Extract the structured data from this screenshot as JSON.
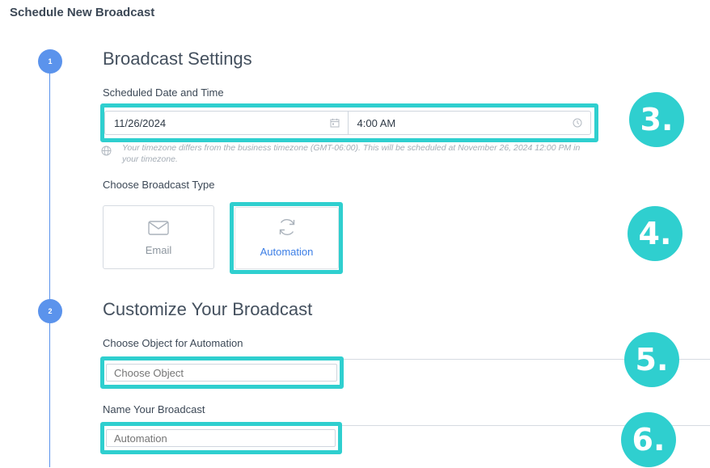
{
  "page": {
    "title": "Schedule New Broadcast"
  },
  "steps": [
    {
      "number": "1",
      "title": "Broadcast Settings"
    },
    {
      "number": "2",
      "title": "Customize Your Broadcast"
    }
  ],
  "schedule": {
    "label": "Scheduled Date and Time",
    "date": "11/26/2024",
    "time": "4:00 AM",
    "timezone_note": "Your timezone differs from the business timezone (GMT-06:00). This will be scheduled at November 26, 2024 12:00 PM in your timezone."
  },
  "broadcast_type": {
    "label": "Choose Broadcast Type",
    "options": [
      {
        "label": "Email",
        "icon": "envelope-icon",
        "selected": false
      },
      {
        "label": "Automation",
        "icon": "refresh-icon",
        "selected": true
      }
    ]
  },
  "object_field": {
    "label": "Choose Object for Automation",
    "placeholder": "Choose Object"
  },
  "name_field": {
    "label": "Name Your Broadcast",
    "placeholder": "Automation"
  },
  "annotations": [
    "3.",
    "4.",
    "5.",
    "6."
  ],
  "colors": {
    "accent": "#5b93ec",
    "highlight": "#2fcfcf",
    "link": "#3d7fe6"
  }
}
